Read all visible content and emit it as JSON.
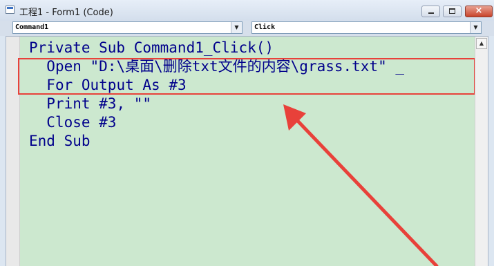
{
  "window": {
    "title": "工程1 - Form1 (Code)",
    "icon": "vb-code-window-icon",
    "close_glyph": "×"
  },
  "toolbar": {
    "object_combo": "Command1",
    "procedure_combo": "Click",
    "dropdown_glyph": "▼"
  },
  "code": {
    "lines": [
      {
        "indent": "",
        "keyword": "Private Sub",
        "text": " Command1_Click()"
      },
      {
        "indent": "  ",
        "keyword": "Open",
        "text": " \"D:\\桌面\\删除txt文件的内容\\grass.txt\" _"
      },
      {
        "indent": "  ",
        "keyword": "For Output As",
        "text": " #3"
      },
      {
        "indent": "  ",
        "keyword": "Print",
        "text": " #3, \"\""
      },
      {
        "indent": "  ",
        "keyword": "Close",
        "text": " #3"
      },
      {
        "indent": "",
        "keyword": "End Sub",
        "text": ""
      }
    ]
  },
  "annotation": {
    "highlight_color": "#e8413a",
    "arrow_color": "#e8413a"
  },
  "scrollbar": {
    "up_glyph": "▲"
  },
  "colors": {
    "code_background": "#cce8cf",
    "code_text": "#00008b"
  }
}
